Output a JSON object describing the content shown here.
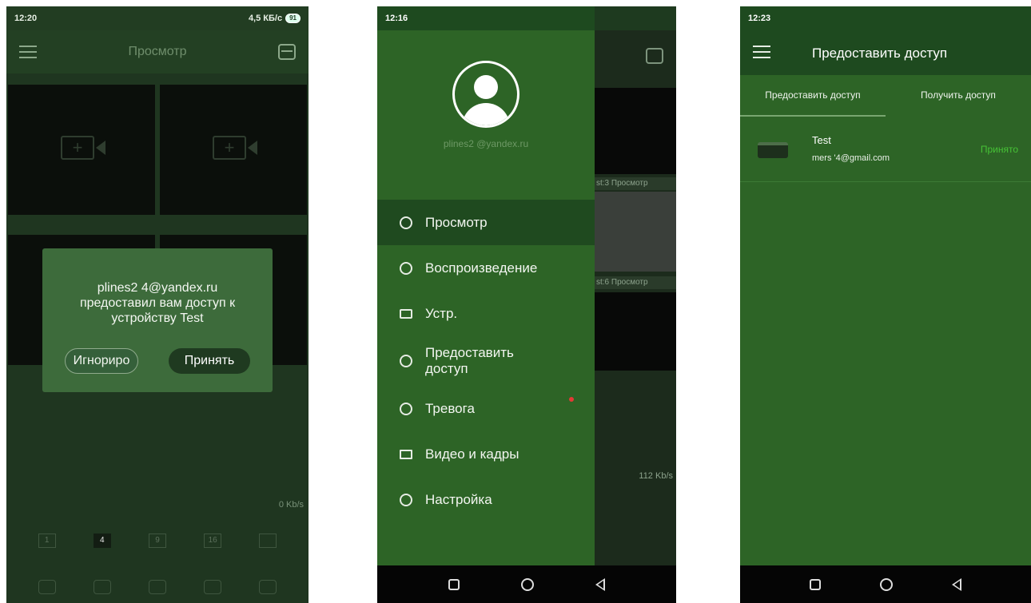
{
  "colors": {
    "accent_green": "#2d6426",
    "dark_green": "#1e4a1f",
    "status_accepted": "#46c236",
    "alarm_dot": "#e53935"
  },
  "screen1": {
    "status_time": "12:20",
    "status_speed": "4,5 КБ/с",
    "battery": "91",
    "title": "Просмотр",
    "dialog": {
      "message": "plines2      4@yandex.ru предоставил вам доступ к устройству Test",
      "ignore_label": "Игнориро",
      "accept_label": "Принять"
    },
    "bitrate": "0 Kb/s",
    "layouts": [
      "1",
      "4",
      "9",
      "16"
    ]
  },
  "screen2": {
    "status_time": "12:16",
    "user": "plines2      @yandex.ru",
    "menu": [
      {
        "label": "Просмотр",
        "icon": "camera-icon"
      },
      {
        "label": "Воспроизведение",
        "icon": "play-icon"
      },
      {
        "label": "Устр.",
        "icon": "device-icon"
      },
      {
        "label": "Предоставить доступ",
        "icon": "share-icon"
      },
      {
        "label": "Тревога",
        "icon": "alarm-icon"
      },
      {
        "label": "Видео и кадры",
        "icon": "folder-icon"
      },
      {
        "label": "Настройка",
        "icon": "settings-icon"
      }
    ],
    "peek": {
      "label1": "st:3 Просмотр",
      "label2": "st:6 Просмотр",
      "bitrate": "112 Kb/s"
    }
  },
  "screen3": {
    "status_time": "12:23",
    "title": "Предоставить доступ",
    "tabs": [
      "Предоставить доступ",
      "Получить доступ"
    ],
    "share": {
      "device": "Test",
      "email": "mers    '4@gmail.com",
      "status": "Принято"
    }
  }
}
